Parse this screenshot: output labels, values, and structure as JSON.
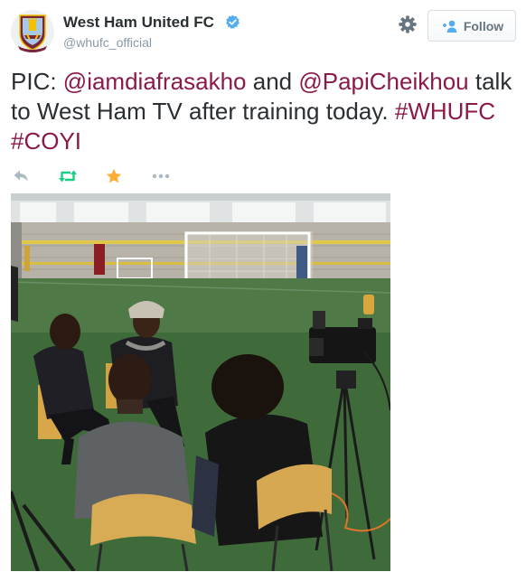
{
  "account": {
    "name": "West Ham United FC",
    "handle": "@whufc_official",
    "verified": true,
    "crest_text": "WEST HAM UNITED"
  },
  "follow_label": "Follow",
  "tweet": {
    "prefix": "PIC: ",
    "mention1": "@iamdiafrasakho",
    "connector": " and ",
    "mention2": "@PapiCheikhou",
    "body": " talk to West Ham TV after training today. ",
    "hashtag1": "#WHUFC",
    "hashtag2": "#COYI"
  },
  "actions": [
    {
      "icon": "reply-icon"
    },
    {
      "icon": "retweet-icon"
    },
    {
      "icon": "favorite-star-icon"
    },
    {
      "icon": "more-icon"
    }
  ],
  "colors": {
    "link": "#8b1a4b",
    "claret": "#7a263a",
    "blue": "#2b7bb9",
    "star": "#ffac33",
    "retweet": "#19cf86"
  }
}
